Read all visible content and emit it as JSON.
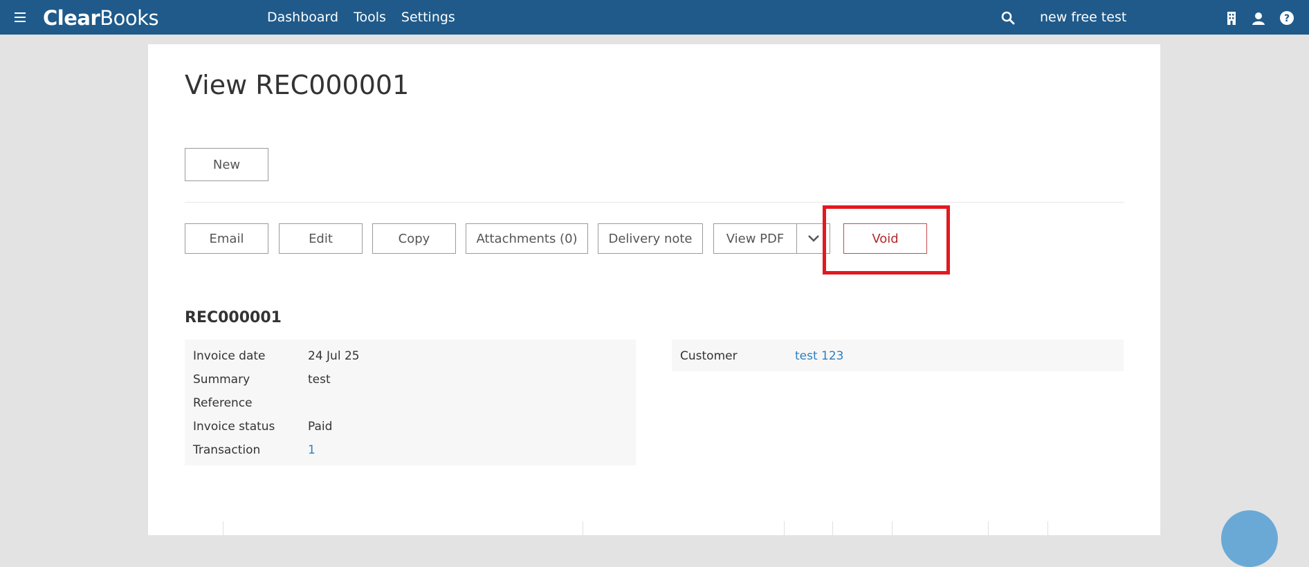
{
  "header": {
    "logo_bold": "Clear",
    "logo_light": "Books",
    "nav": [
      "Dashboard",
      "Tools",
      "Settings"
    ],
    "company_name": "new free test",
    "icons": [
      "menu-icon",
      "search-icon",
      "building-icon",
      "user-icon",
      "help-icon"
    ],
    "bg_color": "#1f5a8a"
  },
  "page": {
    "title": "View REC000001",
    "new_label": "New"
  },
  "actions": {
    "email": "Email",
    "edit": "Edit",
    "copy": "Copy",
    "attachments": "Attachments (0)",
    "delivery_note": "Delivery note",
    "view_pdf": "View PDF",
    "void": "Void"
  },
  "invoice": {
    "number": "REC000001",
    "fields": [
      {
        "label": "Invoice date",
        "value": "24 Jul 25"
      },
      {
        "label": "Summary",
        "value": "test"
      },
      {
        "label": "Reference",
        "value": ""
      },
      {
        "label": "Invoice status",
        "value": "Paid"
      },
      {
        "label": "Transaction",
        "value": "1"
      }
    ],
    "customer_label": "Customer",
    "customer_value": "test 123"
  },
  "colors": {
    "link": "#2b7fc1",
    "void": "#b3282d",
    "highlight": "#e2191f"
  }
}
